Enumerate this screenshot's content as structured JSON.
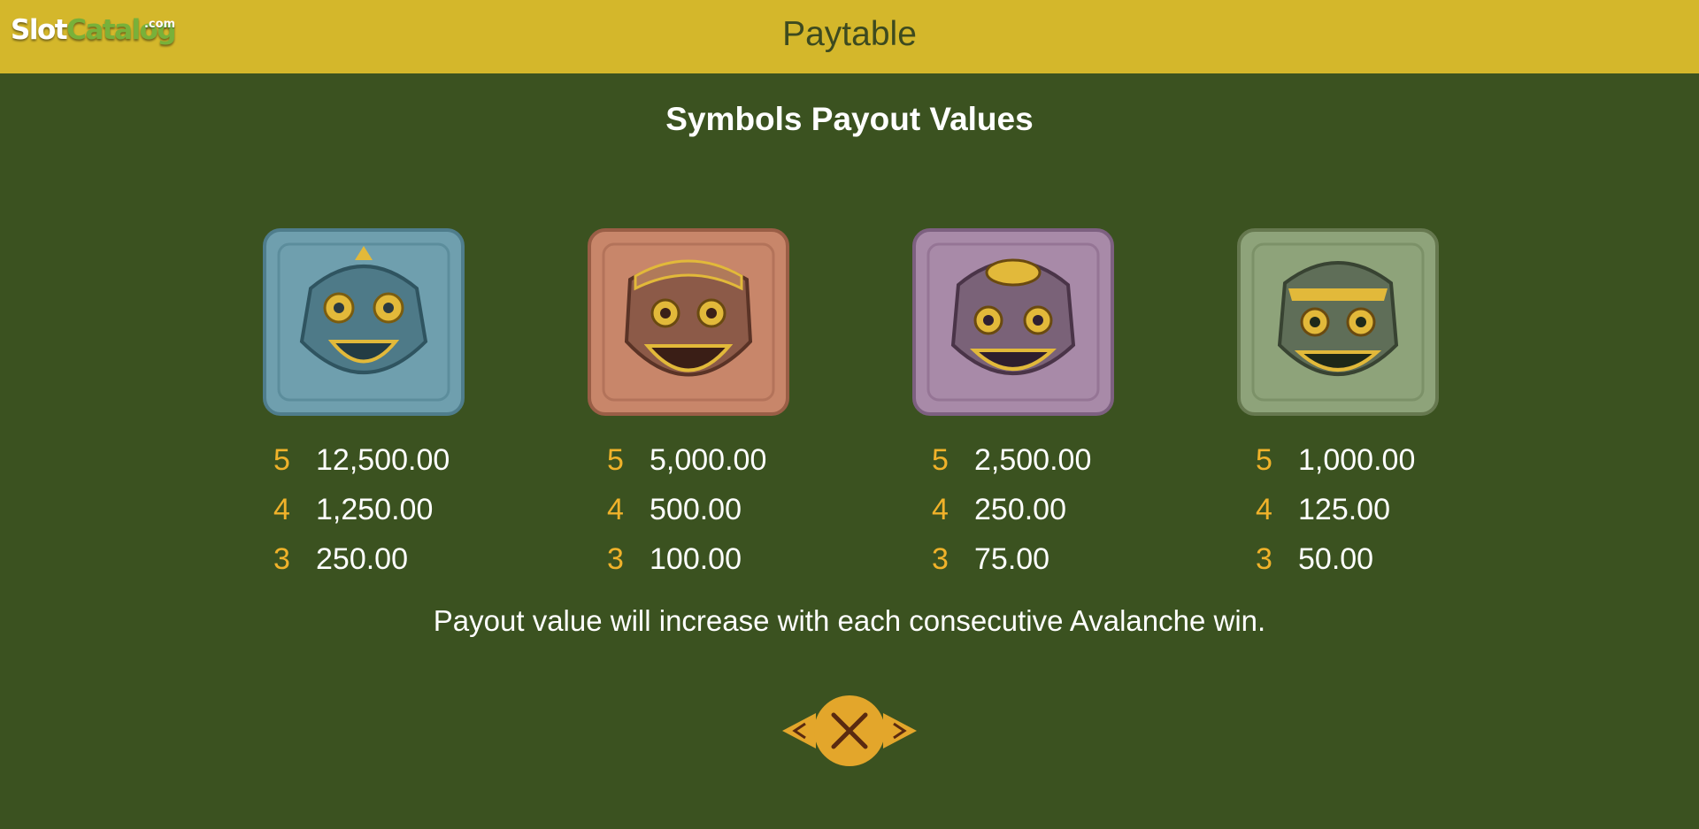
{
  "logo": {
    "slot": "Slot",
    "catalog": "Catalog",
    "com": ".com"
  },
  "header": {
    "title": "Paytable"
  },
  "section_title": "Symbols Payout Values",
  "symbols": [
    {
      "icon": "blue-mask-icon",
      "color": "#6f9fae",
      "payouts": [
        {
          "count": "5",
          "value": "12,500.00"
        },
        {
          "count": "4",
          "value": "1,250.00"
        },
        {
          "count": "3",
          "value": "250.00"
        }
      ]
    },
    {
      "icon": "brown-mask-icon",
      "color": "#c8866a",
      "payouts": [
        {
          "count": "5",
          "value": "5,000.00"
        },
        {
          "count": "4",
          "value": "500.00"
        },
        {
          "count": "3",
          "value": "100.00"
        }
      ]
    },
    {
      "icon": "purple-mask-icon",
      "color": "#a88aa8",
      "payouts": [
        {
          "count": "5",
          "value": "2,500.00"
        },
        {
          "count": "4",
          "value": "250.00"
        },
        {
          "count": "3",
          "value": "75.00"
        }
      ]
    },
    {
      "icon": "green-mask-icon",
      "color": "#8ea37a",
      "payouts": [
        {
          "count": "5",
          "value": "1,000.00"
        },
        {
          "count": "4",
          "value": "125.00"
        },
        {
          "count": "3",
          "value": "50.00"
        }
      ]
    }
  ],
  "footnote": "Payout value will increase with each consecutive Avalanche win.",
  "colors": {
    "header": "#d4b72b",
    "background": "#3b5220",
    "accent": "#f0b22a",
    "nav_button": "#e3a62b"
  }
}
